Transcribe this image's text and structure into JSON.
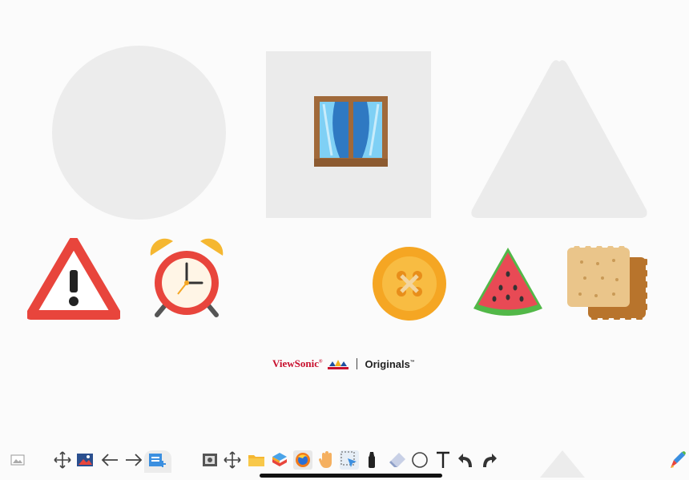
{
  "brand": {
    "name": "ViewSonic",
    "reg": "®",
    "product": "Originals",
    "tm": "™"
  },
  "shapes": [
    {
      "kind": "circle",
      "color": "#ececec"
    },
    {
      "kind": "square",
      "color": "#ebebeb",
      "contains": "window-icon"
    },
    {
      "kind": "triangle",
      "color": "#ebebeb"
    }
  ],
  "stickers": [
    "warning-sign-icon",
    "alarm-clock-icon",
    "button-icon",
    "watermelon-icon",
    "crackers-icon"
  ],
  "toolbar": {
    "left_tools": [
      "image-icon",
      "move-icon",
      "background-icon",
      "arrow-left-icon",
      "arrow-right-icon",
      "add-page-icon"
    ],
    "main_tools": [
      "screenshot-icon",
      "pan-icon",
      "folder-icon",
      "cloud-apps-icon",
      "browser-icon",
      "hand-icon",
      "select-icon",
      "marker-icon",
      "eraser-icon",
      "circle-shape-icon",
      "text-icon",
      "undo-icon",
      "redo-icon"
    ],
    "right_tools": [
      "pen-colors-icon"
    ]
  },
  "colors": {
    "accent_red": "#e8453c",
    "orange": "#f5a623",
    "brand_red": "#c8102e"
  }
}
